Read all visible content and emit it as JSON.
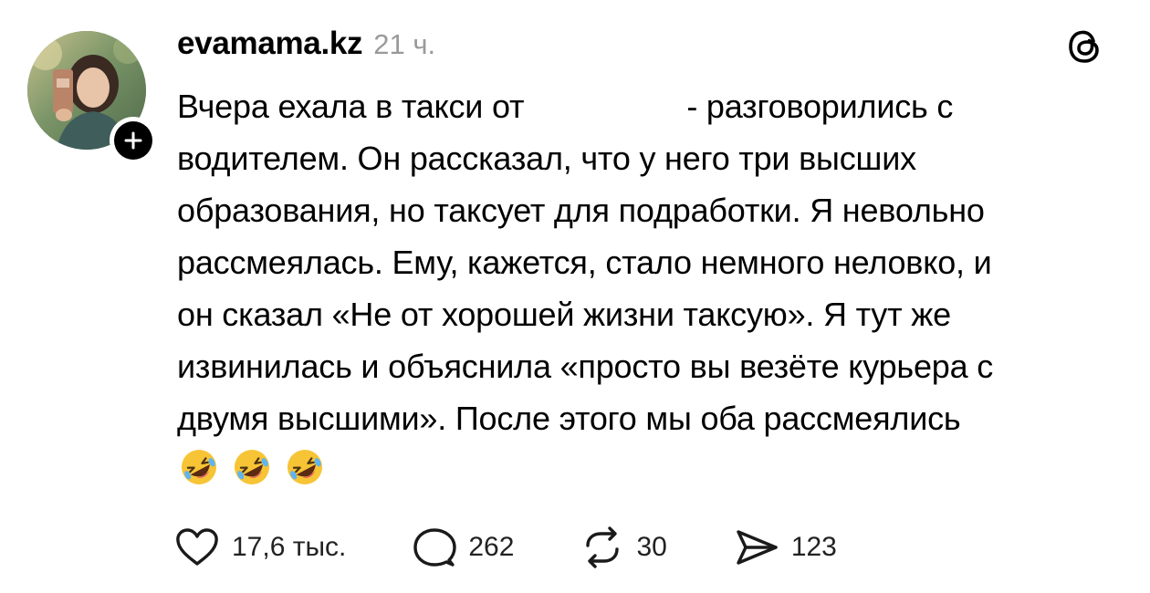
{
  "post": {
    "username": "evamama.kz",
    "timestamp": "21 ч.",
    "text_lines": [
      {
        "before": "Вчера ехала в такси от",
        "after": "- разговорились с"
      },
      "водителем. Он рассказал, что у него три высших",
      "образования, но таксует для подработки. Я невольно",
      "рассмеялась. Ему, кажется, стало немного неловко, и",
      "он сказал «Не от хорошей жизни таксую». Я тут же",
      "извинилась и объяснила «просто вы везёте курьера с",
      "двумя высшими». После этого мы оба рассмеялись"
    ],
    "emojis": [
      "rolling-on-floor-laughing",
      "rolling-on-floor-laughing",
      "rolling-on-floor-laughing"
    ]
  },
  "actions": {
    "likes": "17,6 тыс.",
    "replies": "262",
    "reposts": "30",
    "shares": "123"
  },
  "icons": {
    "like": "heart-icon",
    "reply": "speech-bubble-icon",
    "repost": "repost-icon",
    "share": "send-icon",
    "brand": "threads-logo-icon",
    "follow": "plus-icon"
  },
  "colors": {
    "text": "#000000",
    "muted": "#9a9a9a",
    "icon": "#1a1a1a",
    "background": "#ffffff"
  }
}
